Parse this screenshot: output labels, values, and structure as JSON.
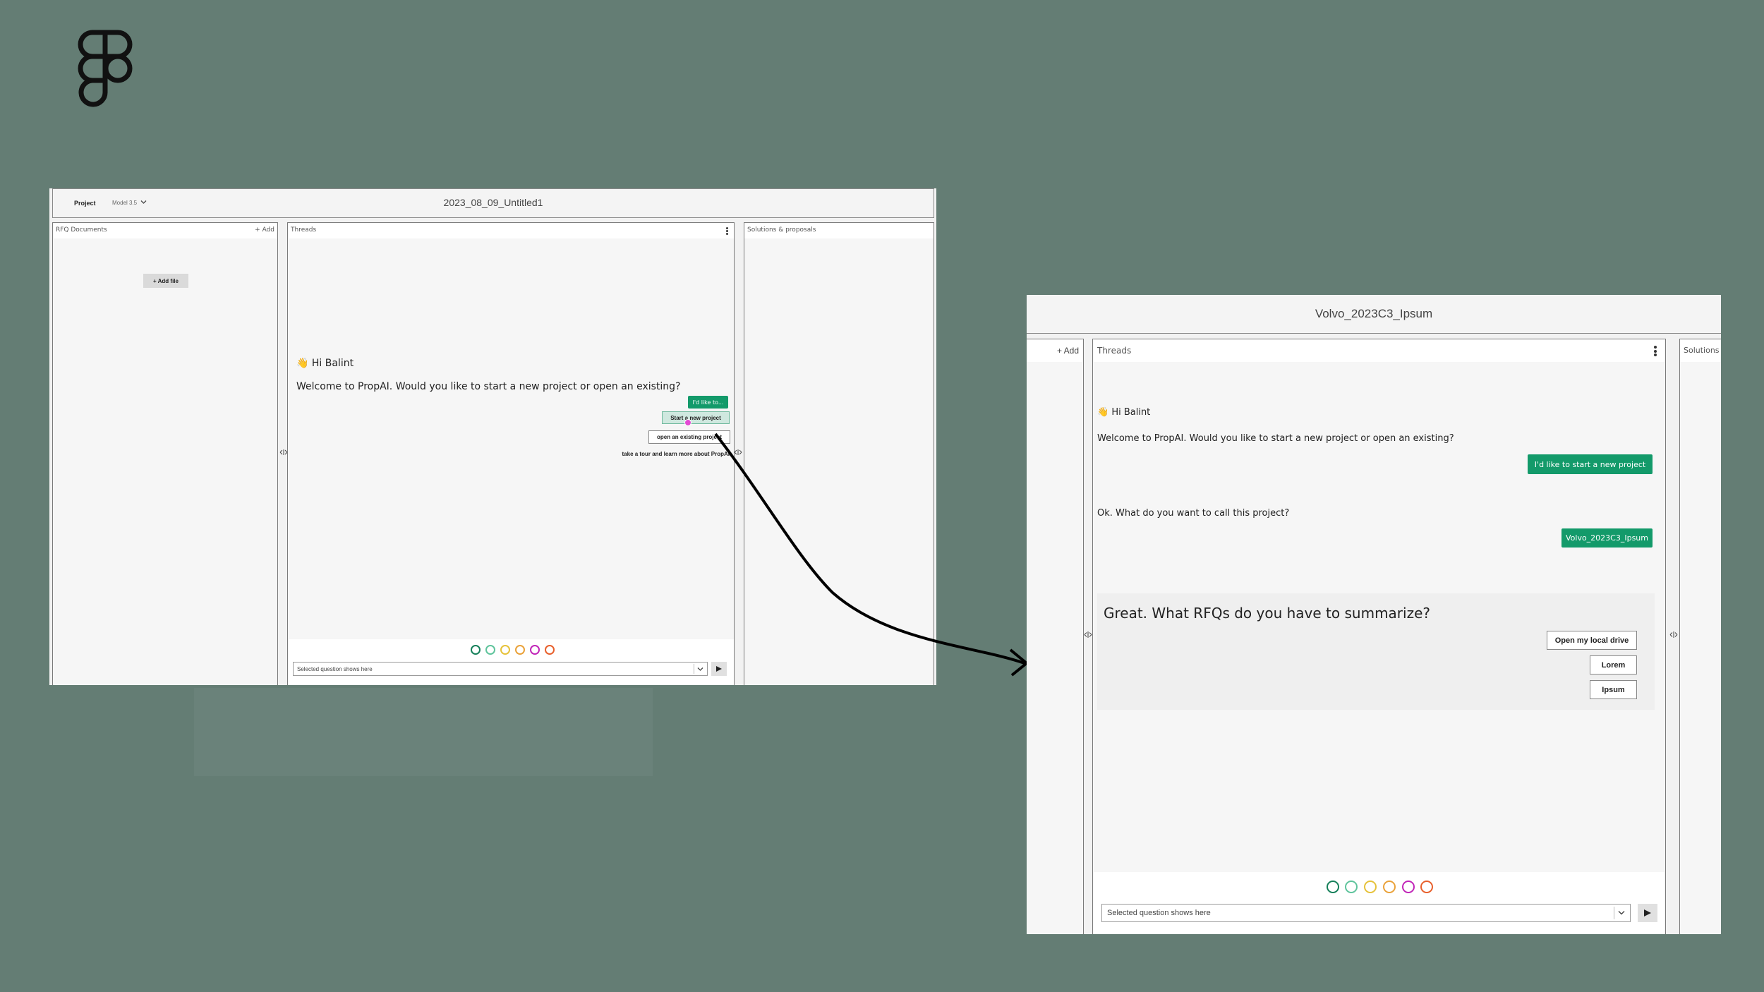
{
  "frame1": {
    "menu": {
      "project_label": "Project",
      "model_label": "Model 3.5"
    },
    "title": "2023_08_09_Untitled1",
    "rfq_panel": {
      "title": "RFQ Documents",
      "add_label": "+ Add",
      "add_file_label": "+ Add file"
    },
    "threads_panel": {
      "title": "Threads",
      "greeting": "👋 Hi Balint",
      "welcome": "Welcome to PropAI. Would you like to start a new project or open an existing?",
      "reply_chip": "I'd like to...",
      "option_start": "Start a new project",
      "option_open": "open an existing project",
      "option_tour": "take a tour and learn more about PropAI",
      "select_placeholder": "Selected question shows here",
      "send_icon": "send-arrow-icon"
    },
    "solutions_panel": {
      "title": "Solutions & proposals"
    }
  },
  "frame2": {
    "title": "Volvo_2023C3_Ipsum",
    "left_add_label": "+ Add",
    "threads_panel": {
      "title": "Threads",
      "greeting": "👋 Hi Balint",
      "welcome": "Welcome to PropAI. Would you like to start a new project or open an existing?",
      "reply1": "I'd like to start a new project",
      "question2": "Ok. What do you want to call this project?",
      "reply2": "Volvo_2023C3_Ipsum",
      "prompt": "Great. What RFQs do you have to summarize?",
      "option1": "Open my local drive",
      "option2": "Lorem",
      "option3": "Ipsum",
      "select_placeholder": "Selected question shows here"
    },
    "solutions_title": "Solutions"
  },
  "colors": {
    "background": "#647d74",
    "accent_green": "#139a6a",
    "dots": [
      "#16805a",
      "#5fc49c",
      "#e6c23a",
      "#eaa23a",
      "#c126b8",
      "#e8602c"
    ]
  }
}
